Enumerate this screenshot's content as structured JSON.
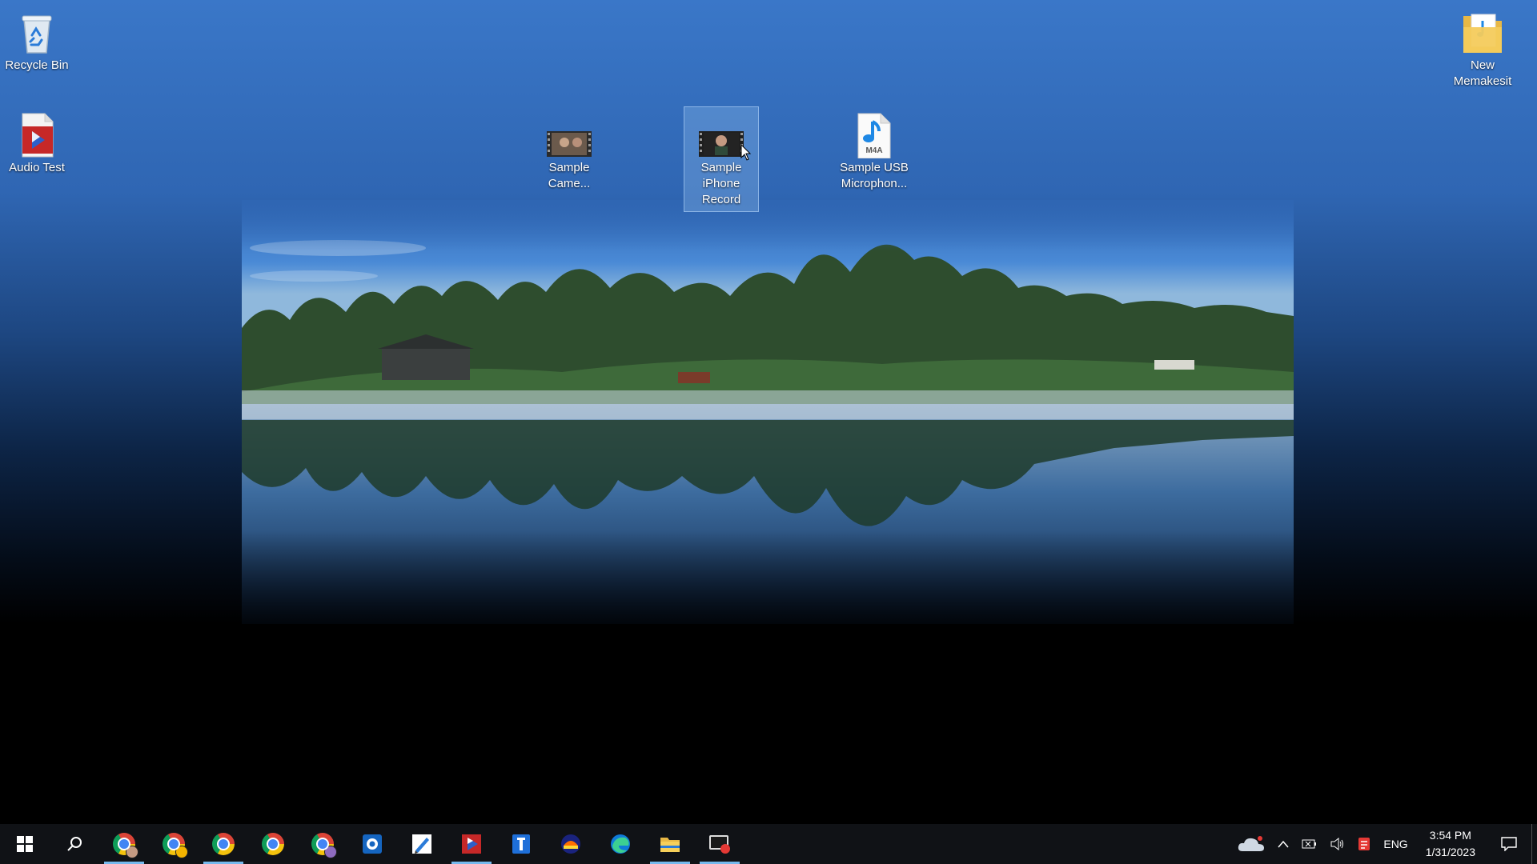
{
  "desktop": {
    "icons": [
      {
        "label": "Recycle Bin",
        "icon": "recycle-bin-icon"
      },
      {
        "label": "Audio Test",
        "icon": "pdf-document-icon"
      },
      {
        "label": "Sample Came...",
        "icon": "video-thumbnail-icon"
      },
      {
        "label": "Sample iPhone Record",
        "icon": "video-thumbnail-icon",
        "selected": true
      },
      {
        "label": "Sample USB Microphon...",
        "icon": "m4a-audio-file-icon",
        "badge": "M4A"
      },
      {
        "label": "New Memakesit",
        "icon": "folder-icon"
      }
    ]
  },
  "taskbar": {
    "start": "windows-start-icon",
    "search": "search-icon",
    "apps": [
      {
        "name": "chrome-profile-1",
        "icon": "chrome-icon",
        "active": true
      },
      {
        "name": "chrome-profile-2",
        "icon": "chrome-icon",
        "active": false
      },
      {
        "name": "chrome-profile-3",
        "icon": "chrome-icon",
        "active": true
      },
      {
        "name": "chrome-profile-4",
        "icon": "chrome-icon",
        "active": false
      },
      {
        "name": "chrome-profile-5",
        "icon": "chrome-icon",
        "active": false
      },
      {
        "name": "app-blue-target",
        "icon": "blue-target-app-icon",
        "active": false
      },
      {
        "name": "app-pen",
        "icon": "pen-app-icon",
        "active": false
      },
      {
        "name": "app-pdf-reader",
        "icon": "pdf-reader-icon",
        "active": true
      },
      {
        "name": "app-blue-tool",
        "icon": "blue-tool-app-icon",
        "active": false
      },
      {
        "name": "app-mixer",
        "icon": "audio-app-icon",
        "active": false
      },
      {
        "name": "edge",
        "icon": "edge-icon",
        "active": false
      },
      {
        "name": "file-explorer",
        "icon": "folder-icon",
        "active": true
      },
      {
        "name": "screen-recorder",
        "icon": "screen-recorder-icon",
        "active": true
      }
    ],
    "tray": {
      "language": "ENG",
      "time": "3:54 PM",
      "date": "1/31/2023"
    }
  },
  "colors": {
    "taskbar_bg": "#101216",
    "active_indicator": "#76b9ed",
    "selection": "#8cb9eb"
  }
}
